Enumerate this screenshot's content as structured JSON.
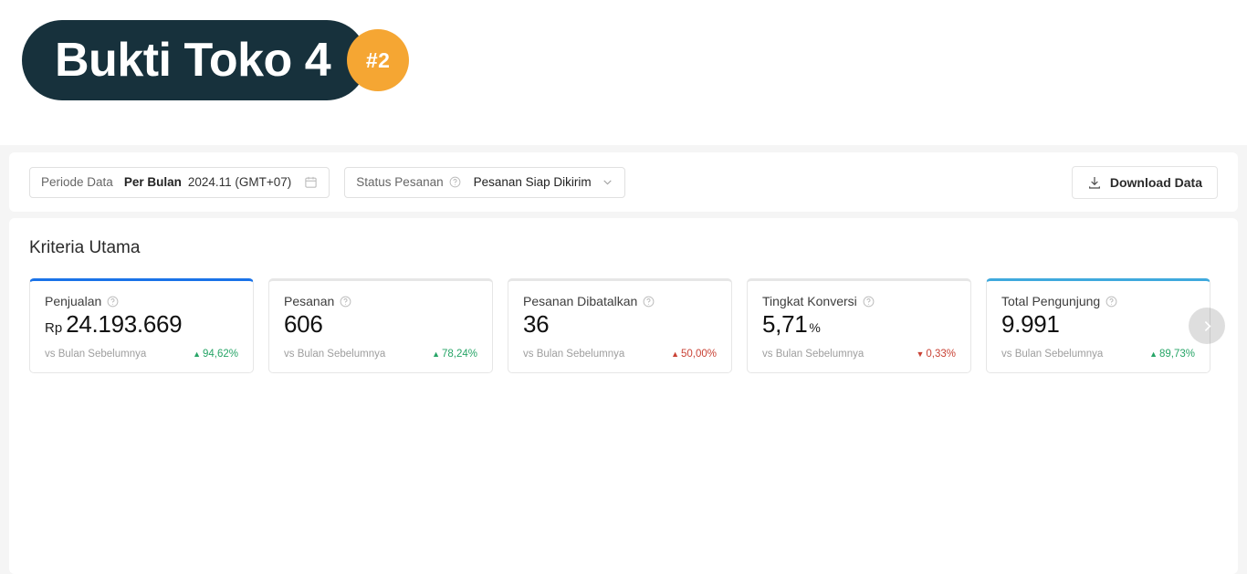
{
  "banner": {
    "title": "Bukti Toko 4",
    "badge": "#2",
    "pill_color": "#17313c",
    "badge_color": "#f5a633"
  },
  "filters": {
    "period": {
      "label": "Periode Data",
      "mode": "Per Bulan",
      "value": "2024.11 (GMT+07)",
      "icon": "calendar-icon"
    },
    "order_status": {
      "label": "Status Pesanan",
      "help_icon": "help-circle-icon",
      "value": "Pesanan Siap Dikirim",
      "chevron_icon": "chevron-down-icon"
    },
    "download": {
      "label": "Download Data",
      "icon": "download-icon"
    }
  },
  "main": {
    "section_title": "Kriteria Utama",
    "comparison_label": "vs Bulan Sebelumnya",
    "next_icon": "chevron-right-icon",
    "colors": {
      "accent_blue": "#1a73e8",
      "accent_cyan": "#3fa9dd",
      "up_green": "#27a567",
      "down_red": "#c94235"
    },
    "cards": [
      {
        "label": "Penjualan",
        "prefix": "Rp",
        "value": "24.193.669",
        "suffix": "",
        "comparison": "vs Bulan Sebelumnya",
        "delta": "94,62%",
        "direction": "up",
        "accent": "blue"
      },
      {
        "label": "Pesanan",
        "prefix": "",
        "value": "606",
        "suffix": "",
        "comparison": "vs Bulan Sebelumnya",
        "delta": "78,24%",
        "direction": "up",
        "accent": "none"
      },
      {
        "label": "Pesanan Dibatalkan",
        "prefix": "",
        "value": "36",
        "suffix": "",
        "comparison": "vs Bulan Sebelumnya",
        "delta": "50,00%",
        "direction": "up-red",
        "accent": "none"
      },
      {
        "label": "Tingkat Konversi",
        "prefix": "",
        "value": "5,71",
        "suffix": "%",
        "comparison": "vs Bulan Sebelumnya",
        "delta": "0,33%",
        "direction": "down",
        "accent": "none"
      },
      {
        "label": "Total Pengunjung",
        "prefix": "",
        "value": "9.991",
        "suffix": "",
        "comparison": "vs Bulan Sebelumnya",
        "delta": "89,73%",
        "direction": "up",
        "accent": "cyan"
      }
    ]
  }
}
